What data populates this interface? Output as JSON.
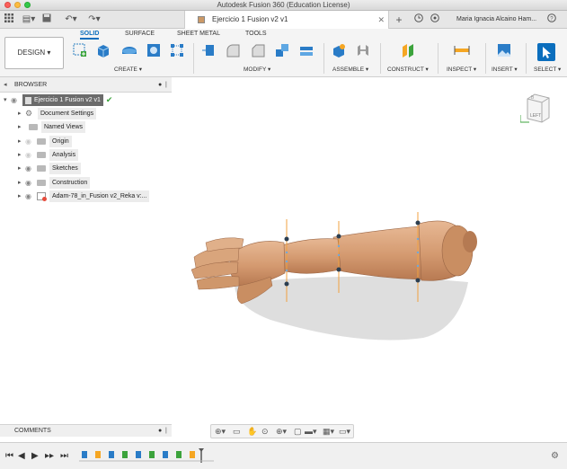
{
  "window": {
    "title": "Autodesk Fusion 360 (Education License)"
  },
  "tabbar": {
    "document_tab": "Ejercicio 1 Fusion v2 v1",
    "user": "Maria Ignacia Alcaino Ham..."
  },
  "ribbon": {
    "workspace": "DESIGN",
    "tabs": [
      "SOLID",
      "SURFACE",
      "SHEET METAL",
      "TOOLS"
    ],
    "groups": [
      "CREATE",
      "MODIFY",
      "ASSEMBLE",
      "CONSTRUCT",
      "INSPECT",
      "INSERT",
      "SELECT"
    ]
  },
  "browser": {
    "title": "BROWSER",
    "root": "Ejercicio 1 Fusion v2 v1",
    "items": [
      "Document Settings",
      "Named Views",
      "Origin",
      "Analysis",
      "Sketches",
      "Construction",
      "Adam-78_in_Fusion v2_Reka v:..."
    ]
  },
  "viewcube": {
    "face": "LEFT"
  },
  "comments": {
    "title": "COMMENTS"
  },
  "colors": {
    "accent": "#0b6ebd",
    "model": "#d7a27a",
    "axis_orange": "#f0a040"
  },
  "icons": [
    "grid-icon",
    "file-icon",
    "save-icon",
    "undo-icon",
    "redo-icon",
    "plus-icon",
    "clock-icon",
    "bell-icon",
    "help-icon",
    "eye-icon",
    "gear-icon",
    "folder-icon",
    "play-icon",
    "settings-icon"
  ]
}
